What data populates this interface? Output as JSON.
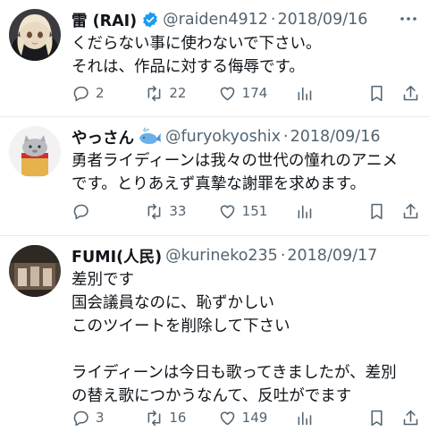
{
  "tweets": [
    {
      "name": "雷 (RAI)",
      "handle": "@raiden4912",
      "separator": "·",
      "date": "2018/09/16",
      "text": "くだらない事に使わないで下さい。\nそれは、作品に対する侮辱です。",
      "replies": "2",
      "retweets": "22",
      "likes": "174",
      "verified": true
    },
    {
      "name": "やっさん",
      "handle": "@furyokyoshix",
      "separator": "·",
      "date": "2018/09/16",
      "text": "勇者ライディーンは我々の世代の憧れのアニメ\nです。とりあえず真摯な謝罪を求めます。",
      "replies": "",
      "retweets": "33",
      "likes": "151"
    },
    {
      "name": "FUMI(人民)",
      "handle": "@kurineko235",
      "separator": "·",
      "date": "2018/09/17",
      "text": "差別です\n国会議員なのに、恥ずかしい\nこのツイートを削除して下さい\n\nライディーンは今日も歌ってきましたが、差別\nの替え歌につかうなんて、反吐がでます",
      "replies": "3",
      "retweets": "16",
      "likes": "149"
    }
  ],
  "icons": {
    "more": "more-icon",
    "reply": "reply-icon",
    "retweet": "retweet-icon",
    "like": "heart-icon",
    "views": "analytics-icon",
    "bookmark": "bookmark-icon",
    "share": "share-icon",
    "verified": "verified-badge-icon",
    "whale": "whale-emoji-icon"
  },
  "colors": {
    "verified": "#1d9bf0",
    "text_primary": "#0f1419",
    "text_secondary": "#536471",
    "whale": "#6ab0e8"
  }
}
